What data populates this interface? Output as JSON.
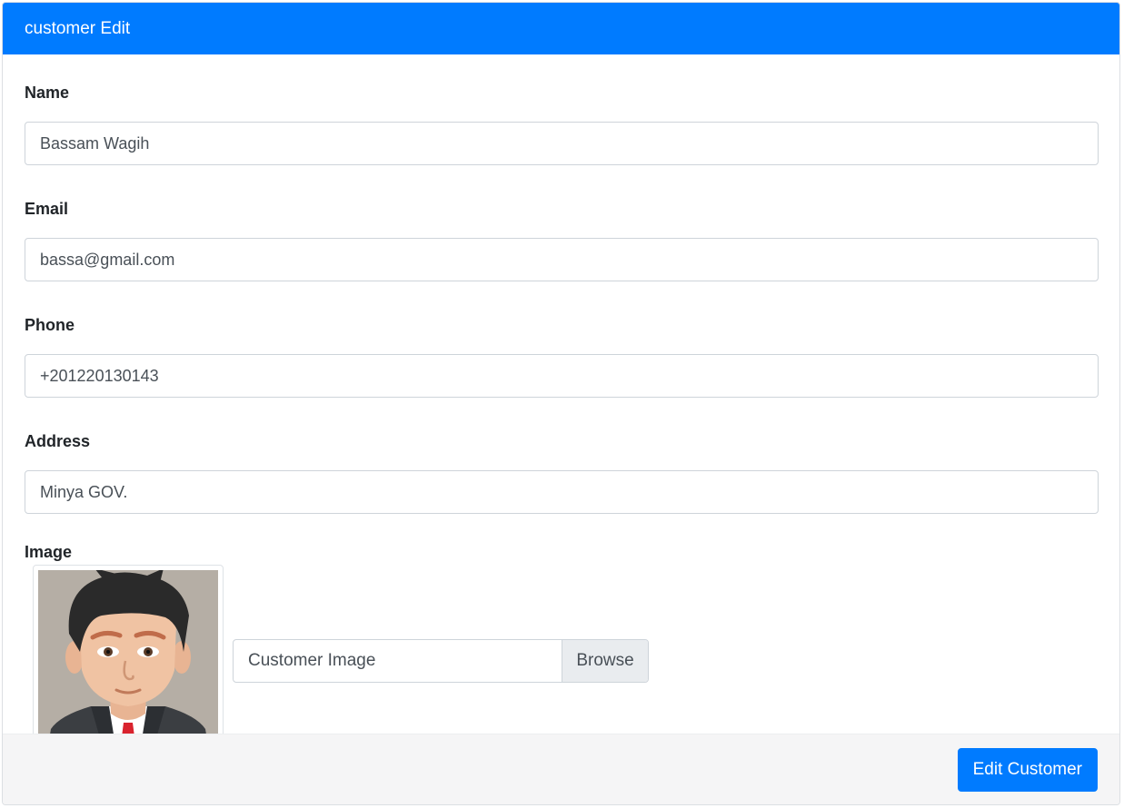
{
  "card": {
    "title": "customer Edit"
  },
  "form": {
    "name": {
      "label": "Name",
      "value": "Bassam Wagih"
    },
    "email": {
      "label": "Email",
      "value": "bassa@gmail.com"
    },
    "phone": {
      "label": "Phone",
      "value": "+201220130143"
    },
    "address": {
      "label": "Address",
      "value": "Minya GOV."
    },
    "image": {
      "label": "Image",
      "file_placeholder": "Customer Image",
      "browse_label": "Browse",
      "avatar_icon": "avatar-cartoon-man"
    }
  },
  "footer": {
    "submit_label": "Edit Customer"
  },
  "colors": {
    "primary": "#007bff",
    "footer_bg": "#f5f5f6",
    "browse_bg": "#e9ecef"
  }
}
